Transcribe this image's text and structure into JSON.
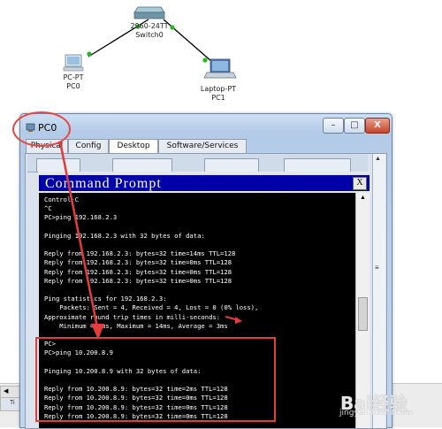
{
  "topology": {
    "switch": {
      "model": "2960-24TT",
      "name": "Switch0"
    },
    "pc": {
      "type": "PC-PT",
      "name": "PC0"
    },
    "laptop": {
      "type": "Laptop-PT",
      "name": "PC1"
    },
    "link_color": "#000000",
    "port_up_color": "#22bb22"
  },
  "window": {
    "title": "PC0",
    "buttons": {
      "minimize": "–",
      "maximize": "□",
      "close": "X"
    }
  },
  "tabs": [
    {
      "label": "Physical",
      "active": false
    },
    {
      "label": "Config",
      "active": false
    },
    {
      "label": "Desktop",
      "active": true
    },
    {
      "label": "Software/Services",
      "active": false
    }
  ],
  "command_prompt": {
    "title": "Command Prompt",
    "close_label": "X",
    "lines": [
      "Control-C",
      "^C",
      "PC>ping 192.168.2.3",
      "",
      "Pinging 192.168.2.3 with 32 bytes of data:",
      "",
      "Reply from 192.168.2.3: bytes=32 time=14ms TTL=128",
      "Reply from 192.168.2.3: bytes=32 time=0ms TTL=128",
      "Reply from 192.168.2.3: bytes=32 time=0ms TTL=128",
      "Reply from 192.168.2.3: bytes=32 time=0ms TTL=128",
      "",
      "Ping statistics for 192.168.2.3:",
      "    Packets: Sent = 4, Received = 4, Lost = 0 (0% loss),",
      "Approximate round trip times in milli-seconds:",
      "    Minimum = 0ms, Maximum = 14ms, Average = 3ms",
      "",
      "PC>",
      "PC>ping 10.200.8.9",
      "",
      "Pinging 10.200.8.9 with 32 bytes of data:",
      "",
      "Reply from 10.200.8.9: bytes=32 time=2ms TTL=128",
      "Reply from 10.200.8.9: bytes=32 time=0ms TTL=128",
      "Reply from 10.200.8.9: bytes=32 time=0ms TTL=128",
      "Reply from 10.200.8.9: bytes=32 time=0ms TTL=128"
    ]
  },
  "status_bar": {
    "text": "Ti"
  },
  "watermark": {
    "brand": "Bai经验",
    "url": "jingyan.baidu.com"
  },
  "annotation_color": "#e43b3b"
}
